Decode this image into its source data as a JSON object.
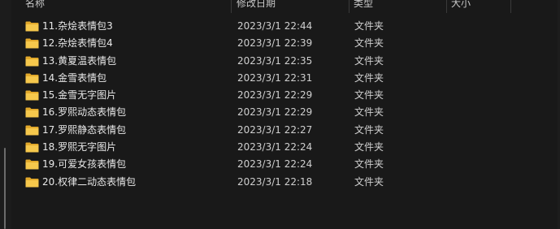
{
  "columns": {
    "name": "名称",
    "date": "修改日期",
    "type": "类型",
    "size": "大小"
  },
  "files": [
    {
      "name": "11.杂烩表情包3",
      "date": "2023/3/1 22:44",
      "type": "文件夹",
      "icon": "folder-icon"
    },
    {
      "name": "12.杂烩表情包4",
      "date": "2023/3/1 22:39",
      "type": "文件夹",
      "icon": "folder-icon"
    },
    {
      "name": "13.黄夏温表情包",
      "date": "2023/3/1 22:35",
      "type": "文件夹",
      "icon": "folder-icon"
    },
    {
      "name": "14.金雪表情包",
      "date": "2023/3/1 22:31",
      "type": "文件夹",
      "icon": "folder-icon"
    },
    {
      "name": "15.金雪无字图片",
      "date": "2023/3/1 22:29",
      "type": "文件夹",
      "icon": "folder-icon"
    },
    {
      "name": "16.罗熙动态表情包",
      "date": "2023/3/1 22:29",
      "type": "文件夹",
      "icon": "folder-icon"
    },
    {
      "name": "17.罗熙静态表情包",
      "date": "2023/3/1 22:27",
      "type": "文件夹",
      "icon": "folder-icon"
    },
    {
      "name": "18.罗熙无字图片",
      "date": "2023/3/1 22:24",
      "type": "文件夹",
      "icon": "folder-icon"
    },
    {
      "name": "19.可爱女孩表情包",
      "date": "2023/3/1 22:24",
      "type": "文件夹",
      "icon": "folder-icon"
    },
    {
      "name": "20.权律二动态表情包",
      "date": "2023/3/1 22:18",
      "type": "文件夹",
      "icon": "folder-icon"
    }
  ],
  "colors": {
    "background": "#191919",
    "folder": "#f4c542",
    "text": "#e8e8e8"
  }
}
